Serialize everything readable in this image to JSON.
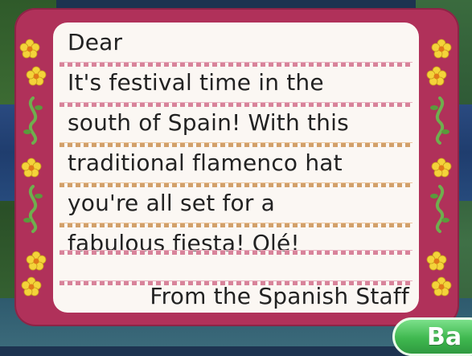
{
  "letter": {
    "greeting": "Dear",
    "body_lines": [
      "It's festival time in the",
      "south of Spain! With this",
      "traditional flamenco hat",
      "you're all set for a",
      "fabulous fiesta! Olé!",
      ""
    ],
    "signature": "From the Spanish Staff"
  },
  "buttons": {
    "back_label": "Ba"
  },
  "colors": {
    "stationery_border": "#b0315a",
    "paper": "#fbf7f3",
    "flower_petal": "#f4d33a",
    "flower_center": "#e07a1a",
    "vine": "#6fae4e",
    "button_green": "#3fb84f"
  },
  "icons": {
    "flower": "yellow-flower-icon",
    "vine": "green-vine-icon"
  }
}
